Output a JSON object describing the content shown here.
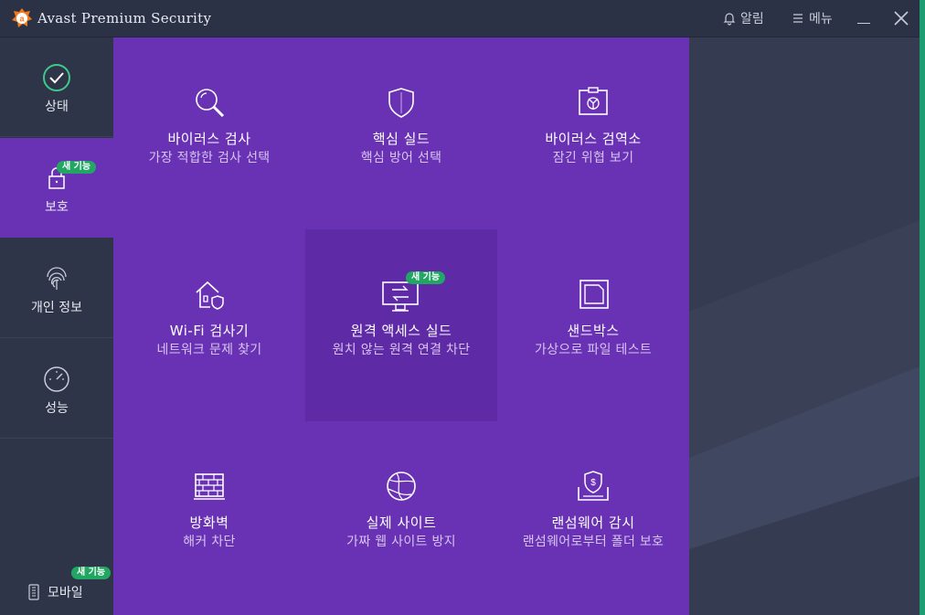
{
  "window": {
    "title": "Avast Premium Security",
    "alerts_label": "알림",
    "menu_label": "메뉴"
  },
  "colors": {
    "accent_purple": "#6932b5",
    "sidebar_bg": "#2f3549",
    "badge_green": "#21a663"
  },
  "sidebar": {
    "items": [
      {
        "label": "상태",
        "icon": "checkmark-circle-icon"
      },
      {
        "label": "보호",
        "icon": "lock-icon",
        "badge": "새 기능"
      },
      {
        "label": "개인 정보",
        "icon": "fingerprint-icon"
      },
      {
        "label": "성능",
        "icon": "speedometer-icon"
      }
    ],
    "mobile": {
      "label": "모바일",
      "icon": "mobile-phone-icon",
      "badge": "새 기능"
    }
  },
  "tiles": [
    {
      "title": "바이러스 검사",
      "subtitle": "가장 적합한 검사 선택",
      "icon": "magnifier-icon"
    },
    {
      "title": "핵심 실드",
      "subtitle": "핵심 방어 선택",
      "icon": "shield-icon"
    },
    {
      "title": "바이러스 검역소",
      "subtitle": "잠긴 위협 보기",
      "icon": "quarantine-icon"
    },
    {
      "title": "Wi-Fi 검사기",
      "subtitle": "네트워크 문제 찾기",
      "icon": "home-network-icon"
    },
    {
      "title": "원격 액세스 실드",
      "subtitle": "원치 않는 원격 연결 차단",
      "icon": "remote-access-icon",
      "badge": "새 기능"
    },
    {
      "title": "샌드박스",
      "subtitle": "가상으로 파일 테스트",
      "icon": "sandbox-icon"
    },
    {
      "title": "방화벽",
      "subtitle": "해커 차단",
      "icon": "firewall-icon"
    },
    {
      "title": "실제 사이트",
      "subtitle": "가짜 웹 사이트 방지",
      "icon": "globe-icon"
    },
    {
      "title": "랜섬웨어 감시",
      "subtitle": "랜섬웨어로부터 폴더 보호",
      "icon": "ransomware-icon"
    }
  ]
}
